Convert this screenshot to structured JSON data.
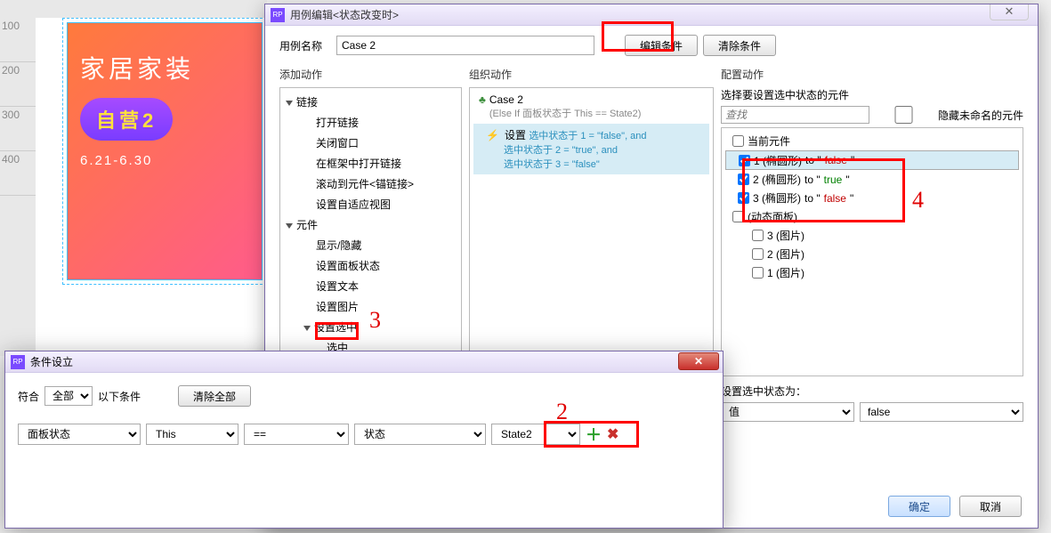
{
  "ruler": [
    "100",
    "200",
    "300",
    "400"
  ],
  "banner": {
    "t1": "家居家装",
    "pill": "自营2",
    "dates": "6.21-6.30"
  },
  "main": {
    "title": "用例编辑<状态改变时>",
    "close": "✕",
    "name_label": "用例名称",
    "name_value": "Case 2",
    "btn_edit_cond": "编辑条件",
    "btn_clear_cond": "清除条件",
    "col_add": "添加动作",
    "col_org": "组织动作",
    "col_cfg": "配置动作",
    "tree": {
      "g1": "链接",
      "g1_items": [
        "打开链接",
        "关闭窗口",
        "在框架中打开链接",
        "滚动到元件<锚链接>",
        "设置自适应视图"
      ],
      "g2": "元件",
      "g2_items": [
        "显示/隐藏",
        "设置面板状态",
        "设置文本",
        "设置图片"
      ],
      "g2_sel_grp": "设置选中",
      "g2_sel_item": "选中"
    },
    "case": {
      "name": "Case 2",
      "elseif": "(Else If 面板状态于 This == State2)",
      "set": "设置",
      "ln1": "选中状态于 1 = \"false\", and",
      "ln2": "选中状态于 2 = \"true\", and",
      "ln3": "选中状态于 3 = \"false\""
    },
    "cfg": {
      "label": "选择要设置选中状态的元件",
      "search_ph": "查找",
      "hide_unnamed": "隐藏未命名的元件",
      "cur": "当前元件",
      "items": [
        {
          "n": "1 (椭圆形)",
          "v": "false"
        },
        {
          "n": "2 (椭圆形)",
          "v": "true"
        },
        {
          "n": "3 (椭圆形)",
          "v": "false"
        }
      ],
      "dyn": "(动态面板)",
      "imgs": [
        "3 (图片)",
        "2 (图片)",
        "1 (图片)"
      ],
      "set_label": "设置选中状态为：",
      "sel1": "值",
      "sel2": "false"
    },
    "ok": "确定",
    "cancel": "取消"
  },
  "cond": {
    "title": "条件设立",
    "match": "符合",
    "all": "全部",
    "following": "以下条件",
    "clear_all": "清除全部",
    "c1": "面板状态",
    "c2": "This",
    "c3": "==",
    "c4": "状态",
    "c5": "State2"
  }
}
